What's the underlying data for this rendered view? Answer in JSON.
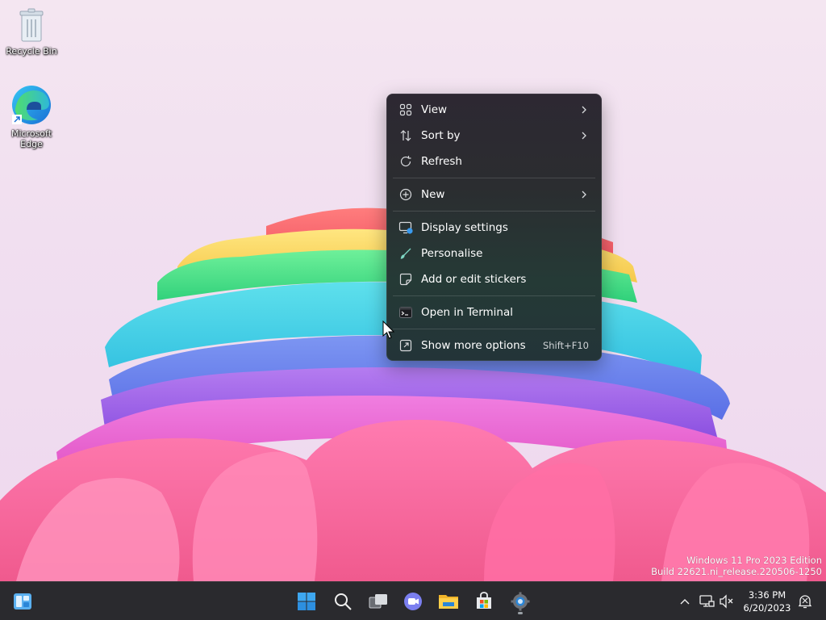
{
  "desktop": {
    "icons": [
      {
        "label": "Recycle Bin",
        "icon": "recycle-bin-icon"
      },
      {
        "label": "Microsoft Edge",
        "icon": "edge-icon"
      }
    ],
    "watermark": {
      "line1": "Windows 11 Pro 2023 Edition",
      "line2": "Build 22621.ni_release.220506-1250"
    }
  },
  "context_menu": {
    "items": [
      {
        "label": "View",
        "icon": "grid-view-icon",
        "submenu": true
      },
      {
        "label": "Sort by",
        "icon": "sort-arrows-icon",
        "submenu": true
      },
      {
        "label": "Refresh",
        "icon": "refresh-icon"
      },
      {
        "label": "New",
        "icon": "new-plus-icon",
        "submenu": true
      },
      {
        "label": "Display settings",
        "icon": "display-settings-icon"
      },
      {
        "label": "Personalise",
        "icon": "brush-icon"
      },
      {
        "label": "Add or edit stickers",
        "icon": "sticker-icon"
      },
      {
        "label": "Open in Terminal",
        "icon": "terminal-icon"
      },
      {
        "label": "Show more options",
        "icon": "more-options-icon",
        "shortcut": "Shift+F10"
      }
    ]
  },
  "taskbar": {
    "widgets": "widgets-icon",
    "apps": [
      {
        "name": "start-button",
        "icon": "windows-start-icon"
      },
      {
        "name": "search-button",
        "icon": "search-icon"
      },
      {
        "name": "task-view-button",
        "icon": "task-view-icon"
      },
      {
        "name": "chat-button",
        "icon": "teams-chat-icon"
      },
      {
        "name": "file-explorer-button",
        "icon": "folder-icon"
      },
      {
        "name": "store-button",
        "icon": "store-icon"
      },
      {
        "name": "settings-button",
        "icon": "gear-icon"
      }
    ],
    "tray": [
      "chevron-up-icon",
      "network-icon",
      "speaker-muted-icon",
      "notification-icon"
    ],
    "clock": {
      "time": "3:36 PM",
      "date": "6/20/2023"
    }
  },
  "colors": {
    "taskbar": "#2a2a2e",
    "menu_text": "#ffffff",
    "accent_blue": "#3a9bef"
  }
}
